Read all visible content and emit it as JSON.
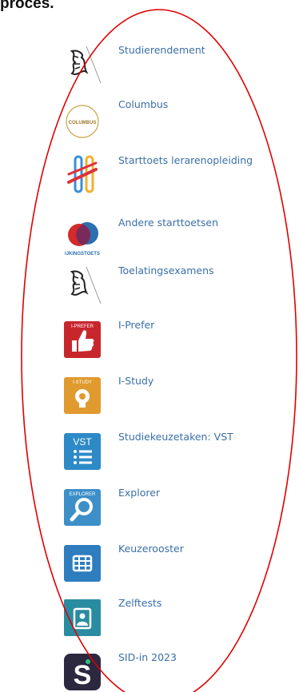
{
  "heading_fragment": "proces.",
  "tools": [
    {
      "label": "Studierendement",
      "icon": "flemish-lion-icon"
    },
    {
      "label": "Columbus",
      "icon": "columbus-logo-icon",
      "icon_text": "COLUMBUS"
    },
    {
      "label": "Starttoets lerarenopleiding",
      "icon": "starttoets-logo-icon"
    },
    {
      "label": "Andere starttoetsen",
      "icon": "ijkingstoets-logo-icon",
      "icon_text": "IJKINGSTOETS"
    },
    {
      "label": "Toelatingsexamens",
      "icon": "flemish-lion-icon"
    },
    {
      "label": "I-Prefer",
      "icon": "i-prefer-thumbs-up-icon",
      "icon_text": "I-PREFER"
    },
    {
      "label": "I-Study",
      "icon": "i-study-lightbulb-icon",
      "icon_text": "I-STUDY"
    },
    {
      "label": "Studiekeuzetaken: VST",
      "icon": "vst-list-icon",
      "icon_text": "VST"
    },
    {
      "label": "Explorer",
      "icon": "explorer-magnifier-icon",
      "icon_text": "EXPLORER"
    },
    {
      "label": "Keuzerooster",
      "icon": "keuzerooster-grid-icon"
    },
    {
      "label": "Zelftests",
      "icon": "zelftests-document-icon"
    },
    {
      "label": "SID-in 2023",
      "icon": "sid-in-logo-icon",
      "icon_text": "S"
    }
  ],
  "colors": {
    "link": "#3a6fa8",
    "annotation_oval": "#e00000",
    "i_prefer": "#c8262d",
    "i_study": "#e09a2e",
    "vst": "#2d8ac7",
    "explorer": "#3d8fc8",
    "keuzerooster": "#2e7dbf",
    "zelftests": "#2a8ca0",
    "sid_in": "#2b2840"
  }
}
